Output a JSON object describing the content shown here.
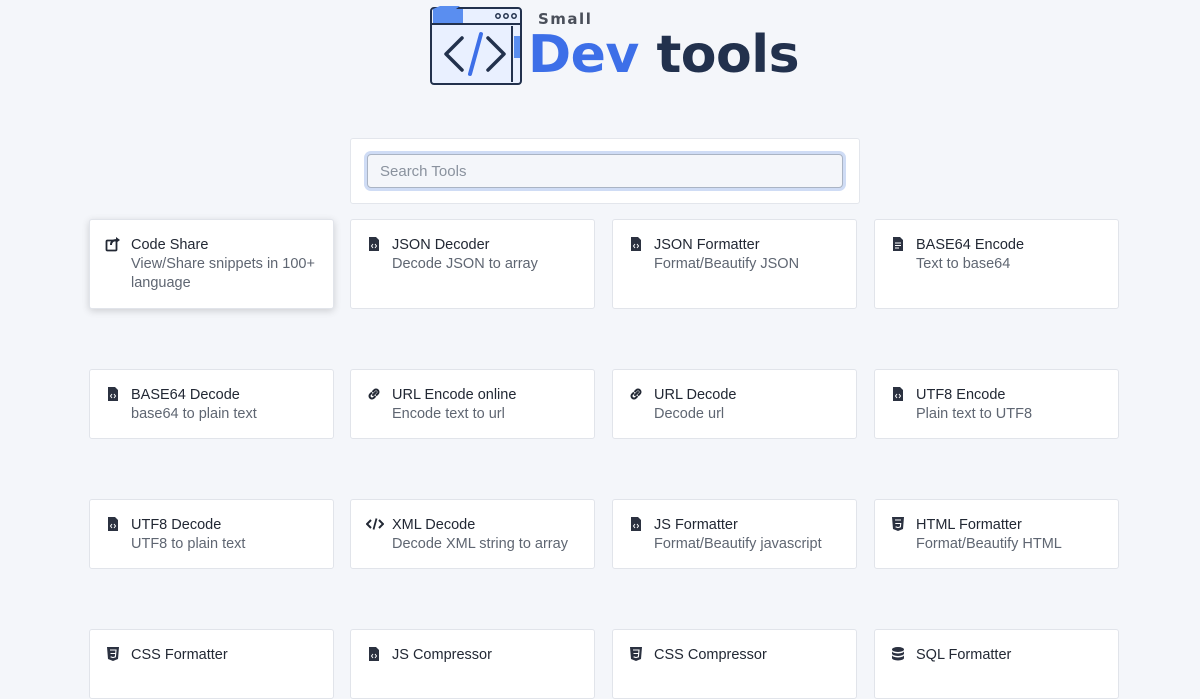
{
  "brand": {
    "small": "Small",
    "dev": "Dev",
    "tools": "tools"
  },
  "search": {
    "placeholder": "Search Tools",
    "value": ""
  },
  "tools": [
    {
      "title": "Code Share",
      "desc": "View/Share snippets in 100+ language",
      "icon": "share-icon"
    },
    {
      "title": "JSON Decoder",
      "desc": "Decode JSON to array",
      "icon": "file-code-icon"
    },
    {
      "title": "JSON Formatter",
      "desc": "Format/Beautify JSON",
      "icon": "file-code-icon"
    },
    {
      "title": "BASE64 Encode",
      "desc": "Text to base64",
      "icon": "file-text-icon"
    },
    {
      "title": "BASE64 Decode",
      "desc": "base64 to plain text",
      "icon": "file-code-icon"
    },
    {
      "title": "URL Encode online",
      "desc": "Encode text to url",
      "icon": "link-icon"
    },
    {
      "title": "URL Decode",
      "desc": "Decode url",
      "icon": "link-icon"
    },
    {
      "title": "UTF8 Encode",
      "desc": "Plain text to UTF8",
      "icon": "file-code-icon"
    },
    {
      "title": "UTF8 Decode",
      "desc": "UTF8 to plain text",
      "icon": "file-code-icon"
    },
    {
      "title": "XML Decode",
      "desc": "Decode XML string to array",
      "icon": "code-icon"
    },
    {
      "title": "JS Formatter",
      "desc": "Format/Beautify javascript",
      "icon": "file-code-icon"
    },
    {
      "title": "HTML Formatter",
      "desc": "Format/Beautify HTML",
      "icon": "html5-icon"
    },
    {
      "title": "CSS Formatter",
      "desc": "",
      "icon": "css3-icon"
    },
    {
      "title": "JS Compressor",
      "desc": "",
      "icon": "file-code-icon"
    },
    {
      "title": "CSS Compressor",
      "desc": "",
      "icon": "css3-icon"
    },
    {
      "title": "SQL Formatter",
      "desc": "",
      "icon": "database-icon"
    }
  ],
  "colors": {
    "accent": "#3d6fe8",
    "dark": "#22314d",
    "background": "#f4f6fa"
  }
}
